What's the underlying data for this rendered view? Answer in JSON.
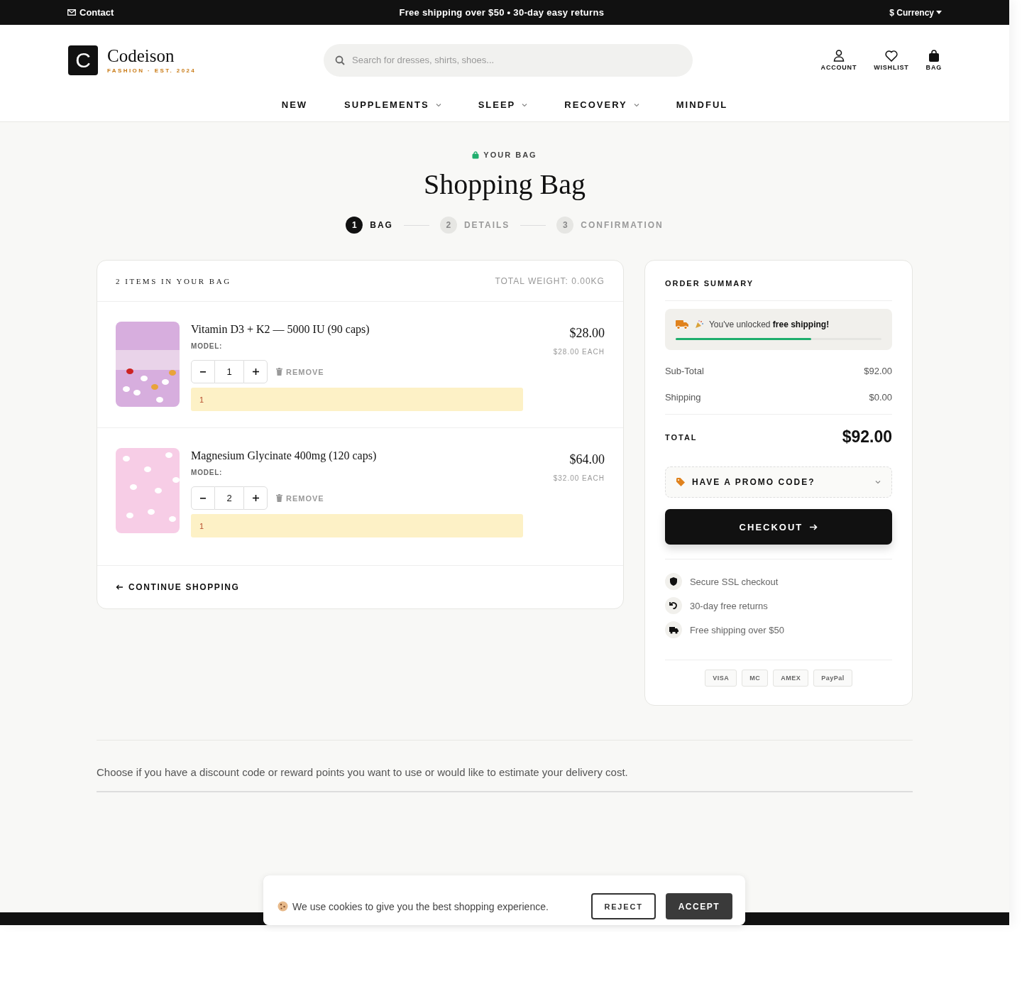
{
  "topbar": {
    "contact": "Contact",
    "announcement": "Free shipping over $50 • 30-day easy returns",
    "currency": "$ Currency"
  },
  "logo": {
    "letter": "C",
    "name": "Codeison",
    "tagline": "FASHION · EST. 2024"
  },
  "search": {
    "placeholder": "Search for dresses, shirts, shoes..."
  },
  "header_actions": [
    {
      "label": "ACCOUNT",
      "kind": "account"
    },
    {
      "label": "WISHLIST",
      "kind": "wishlist"
    },
    {
      "label": "BAG",
      "kind": "bag"
    }
  ],
  "nav": [
    {
      "label": "NEW",
      "dropdown": false
    },
    {
      "label": "SUPPLEMENTS",
      "dropdown": true
    },
    {
      "label": "SLEEP",
      "dropdown": true
    },
    {
      "label": "RECOVERY",
      "dropdown": true
    },
    {
      "label": "MINDFUL",
      "dropdown": false
    }
  ],
  "page": {
    "eyebrow": "YOUR BAG",
    "title": "Shopping Bag"
  },
  "steps": [
    {
      "number": "1",
      "label": "BAG",
      "selected": true
    },
    {
      "number": "2",
      "label": "DETAILS",
      "selected": false
    },
    {
      "number": "3",
      "label": "CONFIRMATION",
      "selected": false
    }
  ],
  "bag": {
    "count_label": "2 ITEMS IN YOUR BAG",
    "weight": "TOTAL WEIGHT: 0.00KG",
    "items": [
      {
        "name": "Vitamin D3 + K2 — 5000 IU (90 caps)",
        "model_label": "MODEL:",
        "quantity": "1",
        "remove": "REMOVE",
        "note": "1",
        "price": "$28.00",
        "each": "$28.00 EACH"
      },
      {
        "name": "Magnesium Glycinate 400mg (120 caps)",
        "model_label": "MODEL:",
        "quantity": "2",
        "remove": "REMOVE",
        "note": "1",
        "price": "$64.00",
        "each": "$32.00 EACH"
      }
    ],
    "continue": "CONTINUE SHOPPING"
  },
  "summary": {
    "title": "ORDER SUMMARY",
    "shipping_banner": {
      "text": "You've unlocked **free shipping!**",
      "level": 0.66
    },
    "rows": [
      {
        "label": "Sub-Total",
        "value": "$92.00"
      },
      {
        "label": "Shipping",
        "value": "$0.00"
      }
    ],
    "total": {
      "label": "TOTAL",
      "value": "$92.00"
    },
    "promo": "HAVE A PROMO CODE?",
    "checkout": "CHECKOUT",
    "trust": [
      {
        "text": "Secure SSL checkout",
        "kind": "shield"
      },
      {
        "text": "30-day free returns",
        "kind": "returns"
      },
      {
        "text": "Free shipping over $50",
        "kind": "truck"
      }
    ],
    "payments": [
      "VISA",
      "MC",
      "AMEX",
      "PayPal"
    ]
  },
  "info_text": "Choose if you have a discount code or reward points you want to use or would like to estimate your delivery cost.",
  "cookie": {
    "text": "We use cookies to give you the best shopping experience.",
    "reject": "REJECT",
    "accept": "ACCEPT"
  }
}
